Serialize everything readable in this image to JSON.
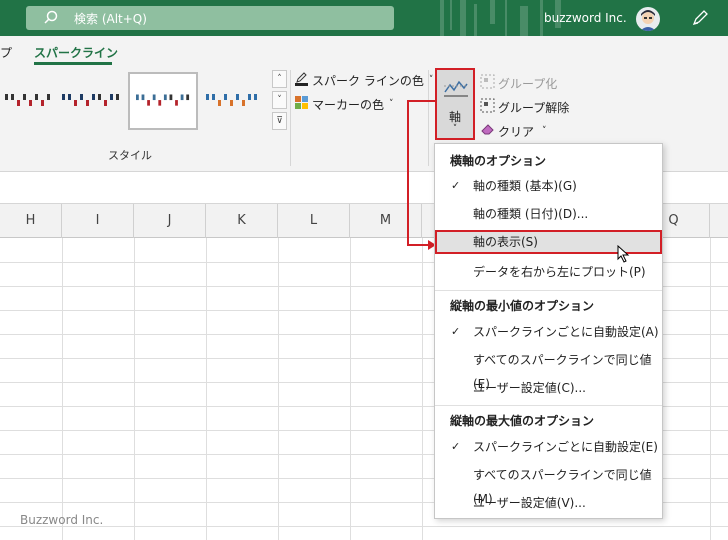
{
  "titlebar": {
    "search_text": "検索 (Alt+Q)",
    "brand": "buzzword Inc."
  },
  "ribbon": {
    "tab_prev": "プ",
    "tab_active": "スパークライン",
    "style_group_label": "スタイル",
    "spark_color": "スパーク ラインの色",
    "marker_color": "マーカーの色",
    "axis_label": "軸",
    "group": "グループ化",
    "ungroup": "グループ解除",
    "clear": "クリア"
  },
  "columns": [
    "H",
    "I",
    "J",
    "K",
    "L",
    "M",
    "Q"
  ],
  "menu": {
    "h_axis_header": "横軸のオプション",
    "h_items": [
      {
        "label": "軸の種類 (基本)(G)",
        "checked": true
      },
      {
        "label": "軸の種類 (日付)(D)...",
        "checked": false
      },
      {
        "label": "軸の表示(S)",
        "checked": false,
        "highlighted": true
      },
      {
        "label": "データを右から左にプロット(P)",
        "checked": false
      }
    ],
    "v_min_header": "縦軸の最小値のオプション",
    "v_min_items": [
      {
        "label": "スパークラインごとに自動設定(A)",
        "checked": true
      },
      {
        "label": "すべてのスパークラインで同じ値(E)",
        "checked": false
      },
      {
        "label": "ユーザー設定値(C)...",
        "checked": false
      }
    ],
    "v_max_header": "縦軸の最大値のオプション",
    "v_max_items": [
      {
        "label": "スパークラインごとに自動設定(E)",
        "checked": true
      },
      {
        "label": "すべてのスパークラインで同じ値(M)",
        "checked": false
      },
      {
        "label": "ユーザー設定値(V)...",
        "checked": false
      }
    ],
    "check_mark": "✓"
  },
  "footer": "Buzzword Inc.",
  "colors": {
    "accent": "#217346",
    "highlight_border": "#d21f26"
  }
}
